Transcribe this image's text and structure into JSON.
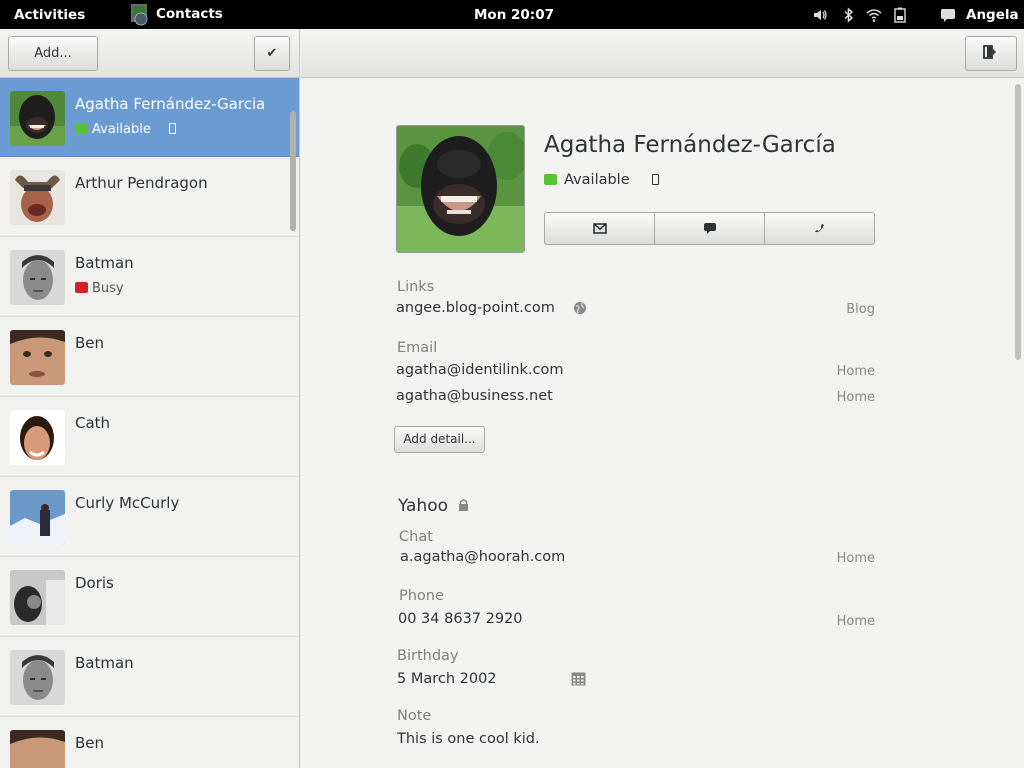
{
  "topbar": {
    "activities": "Activities",
    "app_name": "Contacts",
    "clock": "Mon 20:07",
    "user": "Angela",
    "tray_icons": [
      "volume-icon",
      "bluetooth-icon",
      "wifi-icon",
      "battery-icon",
      "chat-icon"
    ]
  },
  "left_toolbar": {
    "add_label": "Add...",
    "select_icon": "checkmark-icon",
    "select_glyph": "✔"
  },
  "contacts": [
    {
      "name": "Agatha Fernández-Garcia",
      "status": "Available",
      "status_color": "#57c132",
      "selected": true,
      "has_phone": true
    },
    {
      "name": "Arthur Pendragon",
      "status": "",
      "selected": false
    },
    {
      "name": "Batman",
      "status": "Busy",
      "status_color": "#d12222",
      "selected": false
    },
    {
      "name": "Ben",
      "status": "",
      "selected": false
    },
    {
      "name": "Cath",
      "status": "",
      "selected": false
    },
    {
      "name": "Curly McCurly",
      "status": "",
      "selected": false
    },
    {
      "name": "Doris",
      "status": "",
      "selected": false
    },
    {
      "name": "Batman",
      "status": "",
      "selected": false
    },
    {
      "name": "Ben",
      "status": "",
      "selected": false
    }
  ],
  "detail": {
    "name": "Agatha Fernández-García",
    "status": "Available",
    "status_color": "#57c132",
    "actions": [
      "email-icon",
      "chat-icon",
      "phone-icon"
    ],
    "links_label": "Links",
    "link_value": "angee.blog-point.com",
    "link_type": "Blog",
    "email_label": "Email",
    "emails": [
      {
        "value": "agatha@identilink.com",
        "type": "Home"
      },
      {
        "value": "agatha@business.net",
        "type": "Home"
      }
    ],
    "add_detail_label": "Add detail...",
    "yahoo": {
      "title": "Yahoo",
      "chat_label": "Chat",
      "chat_value": "a.agatha@hoorah.com",
      "chat_type": "Home",
      "phone_label": "Phone",
      "phone_value": "00 34 8637 2920",
      "phone_type": "Home",
      "birthday_label": "Birthday",
      "birthday_value": "5 March 2002",
      "note_label": "Note",
      "note_value": "This is one cool kid."
    }
  },
  "colors": {
    "selection": "#6a9bd2",
    "topbar": "#000000",
    "available": "#57c132",
    "busy": "#d12222"
  }
}
